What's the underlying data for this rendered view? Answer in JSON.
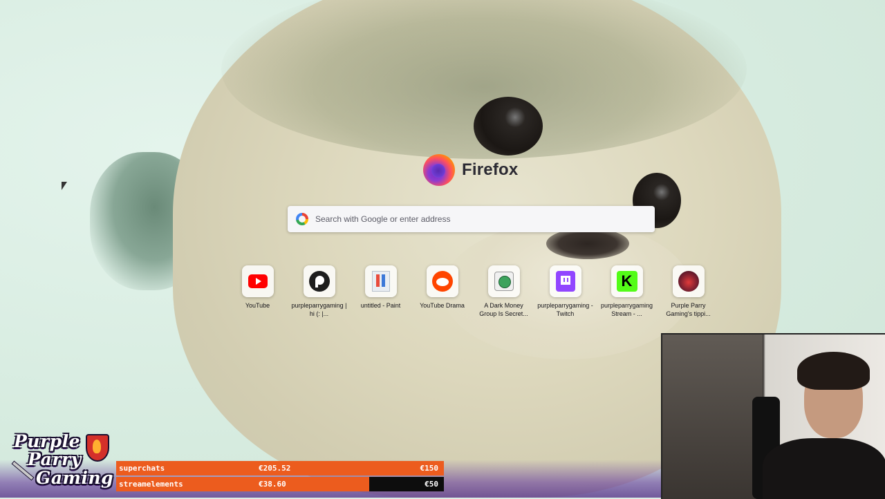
{
  "browser": {
    "brand_name": "Firefox",
    "search": {
      "placeholder": "Search with Google or enter address"
    }
  },
  "shortcuts": [
    {
      "label": "YouTube",
      "icon": "youtube-icon"
    },
    {
      "label": "purpleparrygaming | hi (: |...",
      "icon": "patreon-icon"
    },
    {
      "label": "untitled - Paint",
      "icon": "paint-icon"
    },
    {
      "label": "YouTube Drama",
      "icon": "reddit-icon"
    },
    {
      "label": "A Dark Money Group Is Secret...",
      "icon": "globe-icon"
    },
    {
      "label": "purpleparrygaming - Twitch",
      "icon": "twitch-icon"
    },
    {
      "label": "purpleparrygaming Stream - ...",
      "icon": "kick-icon"
    },
    {
      "label": "Purple Parry Gaming's tippi...",
      "icon": "purple-parry-icon"
    }
  ],
  "overlay": {
    "logo": {
      "line1": "Purple",
      "line2": "Parry",
      "line3": "Gaming"
    },
    "goals": [
      {
        "name": "superchats",
        "value": "€205.52",
        "goal": "€150",
        "progress": 1.0
      },
      {
        "name": "streamelements",
        "value": "€38.60",
        "goal": "€50",
        "progress": 0.772
      }
    ],
    "accent_color": "#ec5c1e",
    "track_color": "#0d0d0d"
  }
}
